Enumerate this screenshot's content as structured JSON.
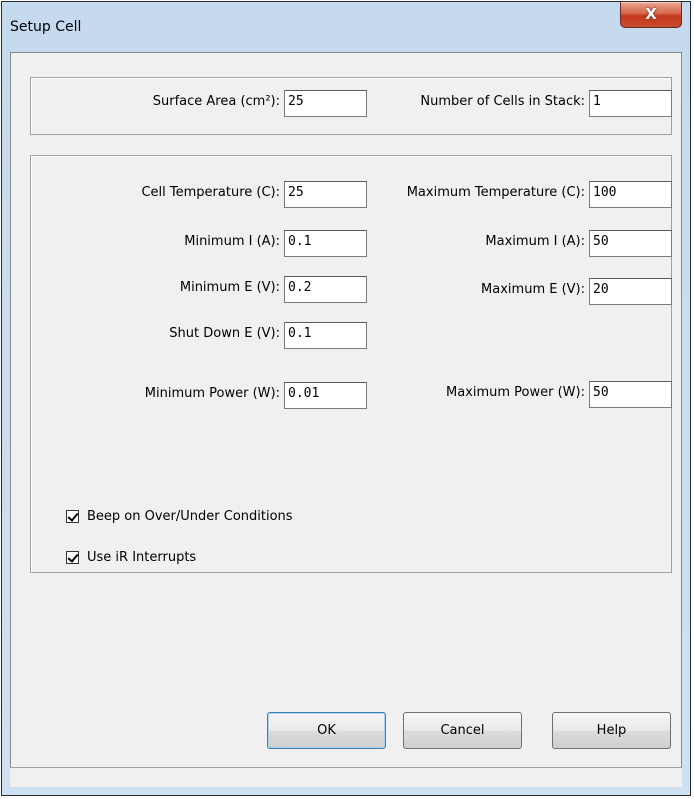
{
  "window": {
    "title": "Setup Cell",
    "close_label": "X"
  },
  "cell_group": {
    "surface_area": {
      "label": "Surface Area (cm²):",
      "value": "25"
    },
    "cells_in_stack": {
      "label": "Number of Cells in Stack:",
      "value": "1"
    }
  },
  "limits_group": {
    "cell_temperature": {
      "label": "Cell Temperature (C):",
      "value": "25"
    },
    "max_temperature": {
      "label": "Maximum Temperature (C):",
      "value": "100"
    },
    "min_current": {
      "label": "Minimum I (A):",
      "value": "0.1"
    },
    "max_current": {
      "label": "Maximum I (A):",
      "value": "50"
    },
    "min_voltage": {
      "label": "Minimum E (V):",
      "value": "0.2"
    },
    "max_voltage": {
      "label": "Maximum E (V):",
      "value": "20"
    },
    "shutdown_voltage": {
      "label": "Shut Down E (V):",
      "value": "0.1"
    },
    "min_power": {
      "label": "Minimum Power (W):",
      "value": "0.01"
    },
    "max_power": {
      "label": "Maximum Power (W):",
      "value": "50"
    },
    "beep_option": {
      "label": "Beep on Over/Under Conditions",
      "checked": true
    },
    "ir_option": {
      "label": "Use iR Interrupts",
      "checked": true
    }
  },
  "buttons": {
    "ok": "OK",
    "cancel": "Cancel",
    "help": "Help"
  }
}
